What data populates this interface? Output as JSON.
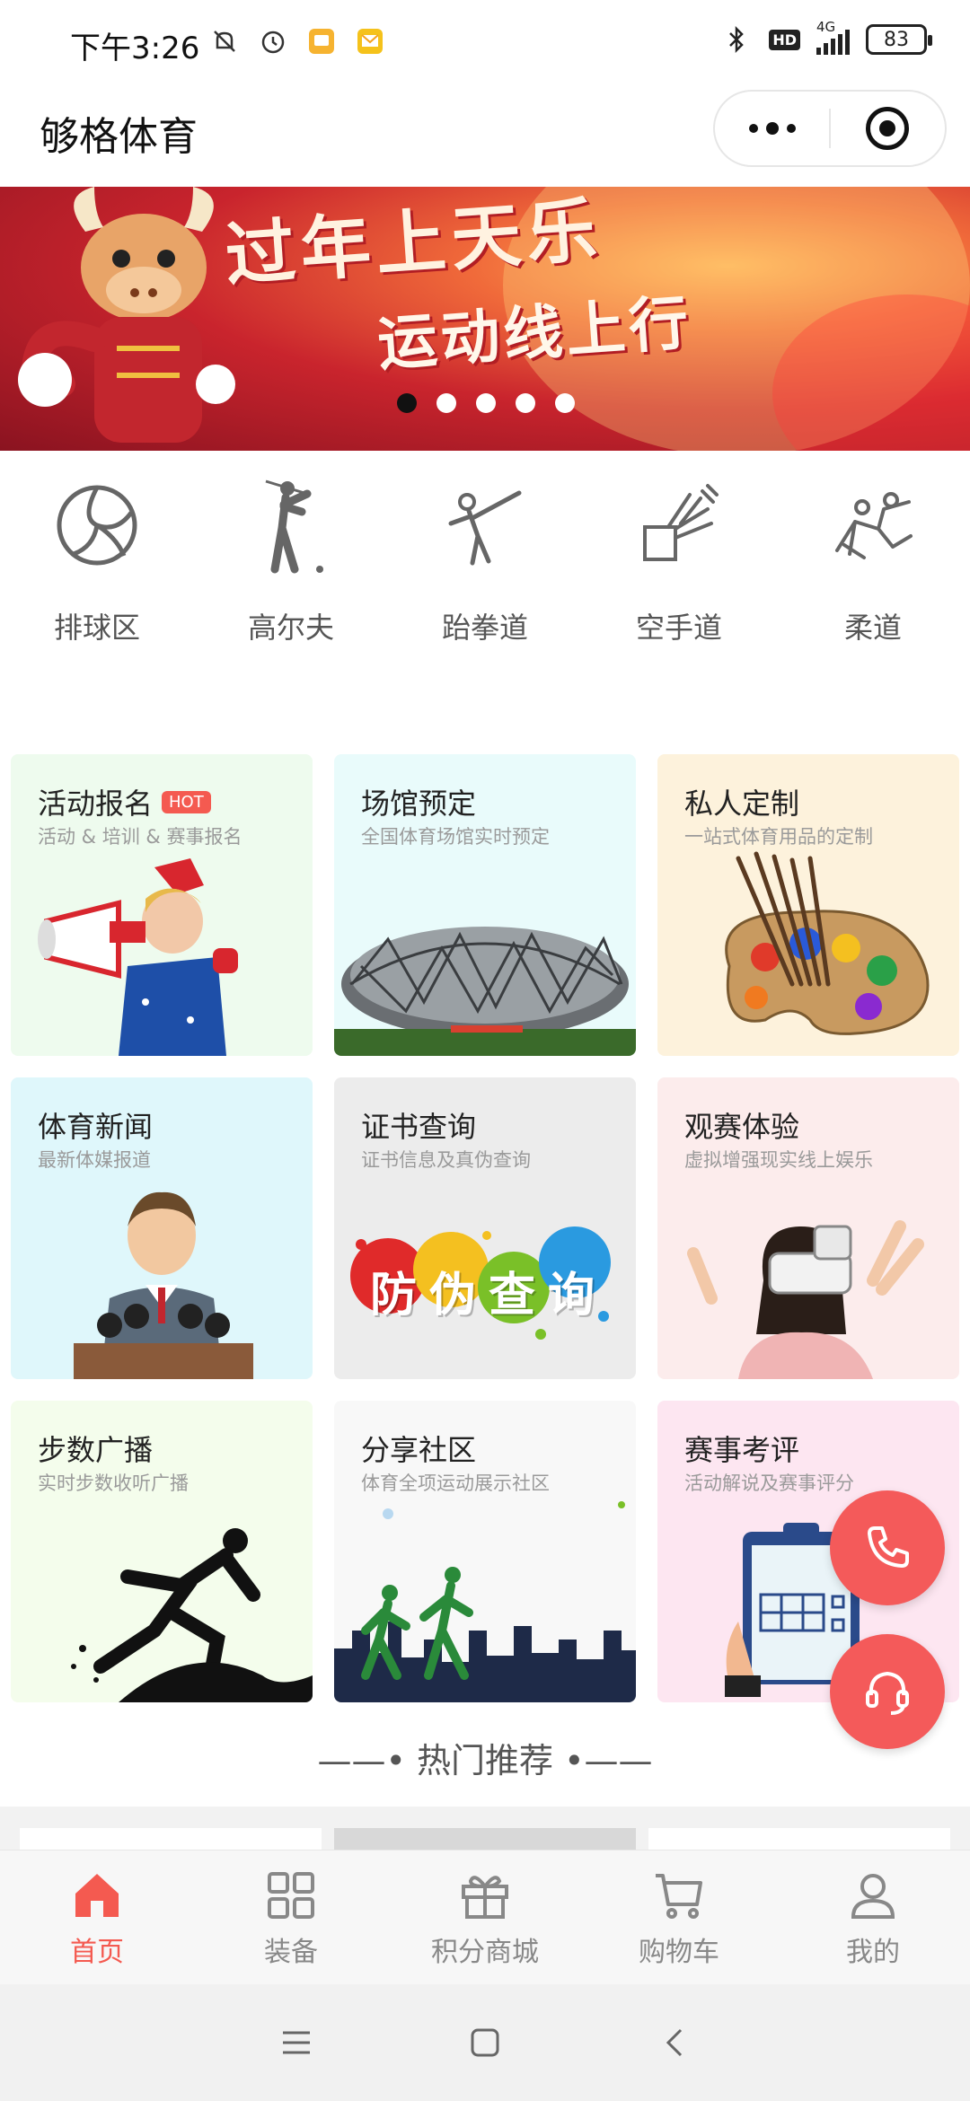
{
  "status_bar": {
    "time": "下午3:26",
    "network": "4G",
    "hd": "HD",
    "battery": "83"
  },
  "header": {
    "title": "够格体育"
  },
  "banner": {
    "headline1": "过年上天乐",
    "headline2": "运动线上行",
    "slides": 5,
    "active_slide": 1
  },
  "categories": [
    {
      "label": "排球区",
      "icon": "volleyball-icon"
    },
    {
      "label": "高尔夫",
      "icon": "golf-icon"
    },
    {
      "label": "跆拳道",
      "icon": "taekwondo-icon"
    },
    {
      "label": "空手道",
      "icon": "karate-icon"
    },
    {
      "label": "柔道",
      "icon": "judo-icon"
    }
  ],
  "features": [
    {
      "title": "活动报名",
      "badge": "HOT",
      "subtitle": "活动 & 培训 & 赛事报名",
      "bg": "#eefbee"
    },
    {
      "title": "场馆预定",
      "subtitle": "全国体育场馆实时预定",
      "bg": "#e9fbfb"
    },
    {
      "title": "私人定制",
      "subtitle": "一站式体育用品的定制",
      "bg": "#fdf2dc"
    },
    {
      "title": "体育新闻",
      "subtitle": "最新体媒报道",
      "bg": "#dff7fb"
    },
    {
      "title": "证书查询",
      "subtitle": "证书信息及真伪查询",
      "bg": "#ececec"
    },
    {
      "title": "观赛体验",
      "subtitle": "虚拟增强现实线上娱乐",
      "bg": "#fcecec"
    },
    {
      "title": "步数广播",
      "subtitle": "实时步数收听广播",
      "bg": "#f4fdec"
    },
    {
      "title": "分享社区",
      "subtitle": "体育全项运动展示社区",
      "bg": "#f8f8f8"
    },
    {
      "title": "赛事考评",
      "subtitle": "活动解说及赛事评分",
      "bg": "#fde6f1"
    }
  ],
  "cert_art_text": "防伪查询",
  "section_title": "——• 热门推荐 •——",
  "tabs": [
    {
      "label": "首页",
      "icon": "home-icon",
      "active": true
    },
    {
      "label": "装备",
      "icon": "grid-icon",
      "active": false
    },
    {
      "label": "积分商城",
      "icon": "gift-icon",
      "active": false
    },
    {
      "label": "购物车",
      "icon": "cart-icon",
      "active": false
    },
    {
      "label": "我的",
      "icon": "user-icon",
      "active": false
    }
  ],
  "colors": {
    "accent": "#f45a50",
    "fab": "#f45a5a",
    "tab_inactive": "#888888"
  }
}
